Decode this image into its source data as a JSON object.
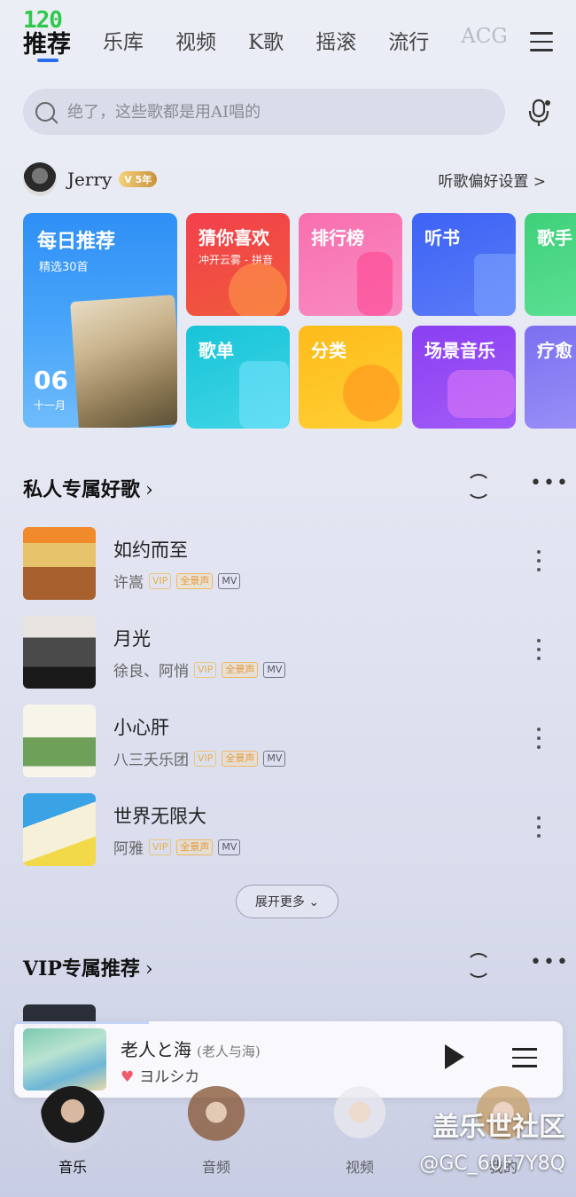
{
  "status": {
    "fps": "120"
  },
  "tabs": [
    {
      "label": "推荐",
      "active": true
    },
    {
      "label": "乐库"
    },
    {
      "label": "视频"
    },
    {
      "label": "K歌"
    },
    {
      "label": "摇滚"
    },
    {
      "label": "流行"
    },
    {
      "label": "ACG"
    }
  ],
  "search": {
    "placeholder": "绝了，这些歌都是用AI唱的"
  },
  "user": {
    "name": "Jerry",
    "vip_level": "5年",
    "preference_link": "听歌偏好设置 >"
  },
  "grid": {
    "daily": {
      "title": "每日推荐",
      "subtitle": "精选30首",
      "day": "06",
      "month": "十一月"
    },
    "cards": [
      {
        "title": "猜你喜欢",
        "subtitle": "冲开云雾 - 拼音"
      },
      {
        "title": "排行榜"
      },
      {
        "title": "听书"
      },
      {
        "title": "歌手"
      },
      {
        "title": "歌单"
      },
      {
        "title": "分类"
      },
      {
        "title": "场景音乐"
      },
      {
        "title": "疗愈"
      }
    ]
  },
  "private_section": {
    "title": "私人专属好歌",
    "chevron": "›"
  },
  "songs": [
    {
      "name": "如约而至",
      "artist": "许嵩",
      "tags": [
        "VIP",
        "全景声",
        "MV"
      ]
    },
    {
      "name": "月光",
      "artist": "徐良、阿悄",
      "tags": [
        "VIP",
        "全景声",
        "MV"
      ]
    },
    {
      "name": "小心肝",
      "artist": "八三夭乐团",
      "tags": [
        "VIP",
        "全景声",
        "MV"
      ]
    },
    {
      "name": "世界无限大",
      "artist": "阿雅",
      "tags": [
        "VIP",
        "全景声",
        "MV"
      ]
    }
  ],
  "expand_button": "展开更多 ⌄",
  "vip_section": {
    "title": "VIP专属推荐",
    "chevron": "›"
  },
  "player": {
    "title": "老人と海",
    "subtitle": "(老人与海)",
    "artist": "ヨルシカ",
    "progress": 0.25
  },
  "bottom_nav": [
    {
      "label": "音乐",
      "active": true
    },
    {
      "label": "音频"
    },
    {
      "label": "视频"
    },
    {
      "label": "我的"
    }
  ],
  "watermark": {
    "line1": "盖乐世社区",
    "line2": "@GC_60F7Y8Q"
  },
  "colors": {
    "accent": "#2a6cf0",
    "fps": "#2ec94a",
    "vip_tag": "#e4b04e"
  }
}
